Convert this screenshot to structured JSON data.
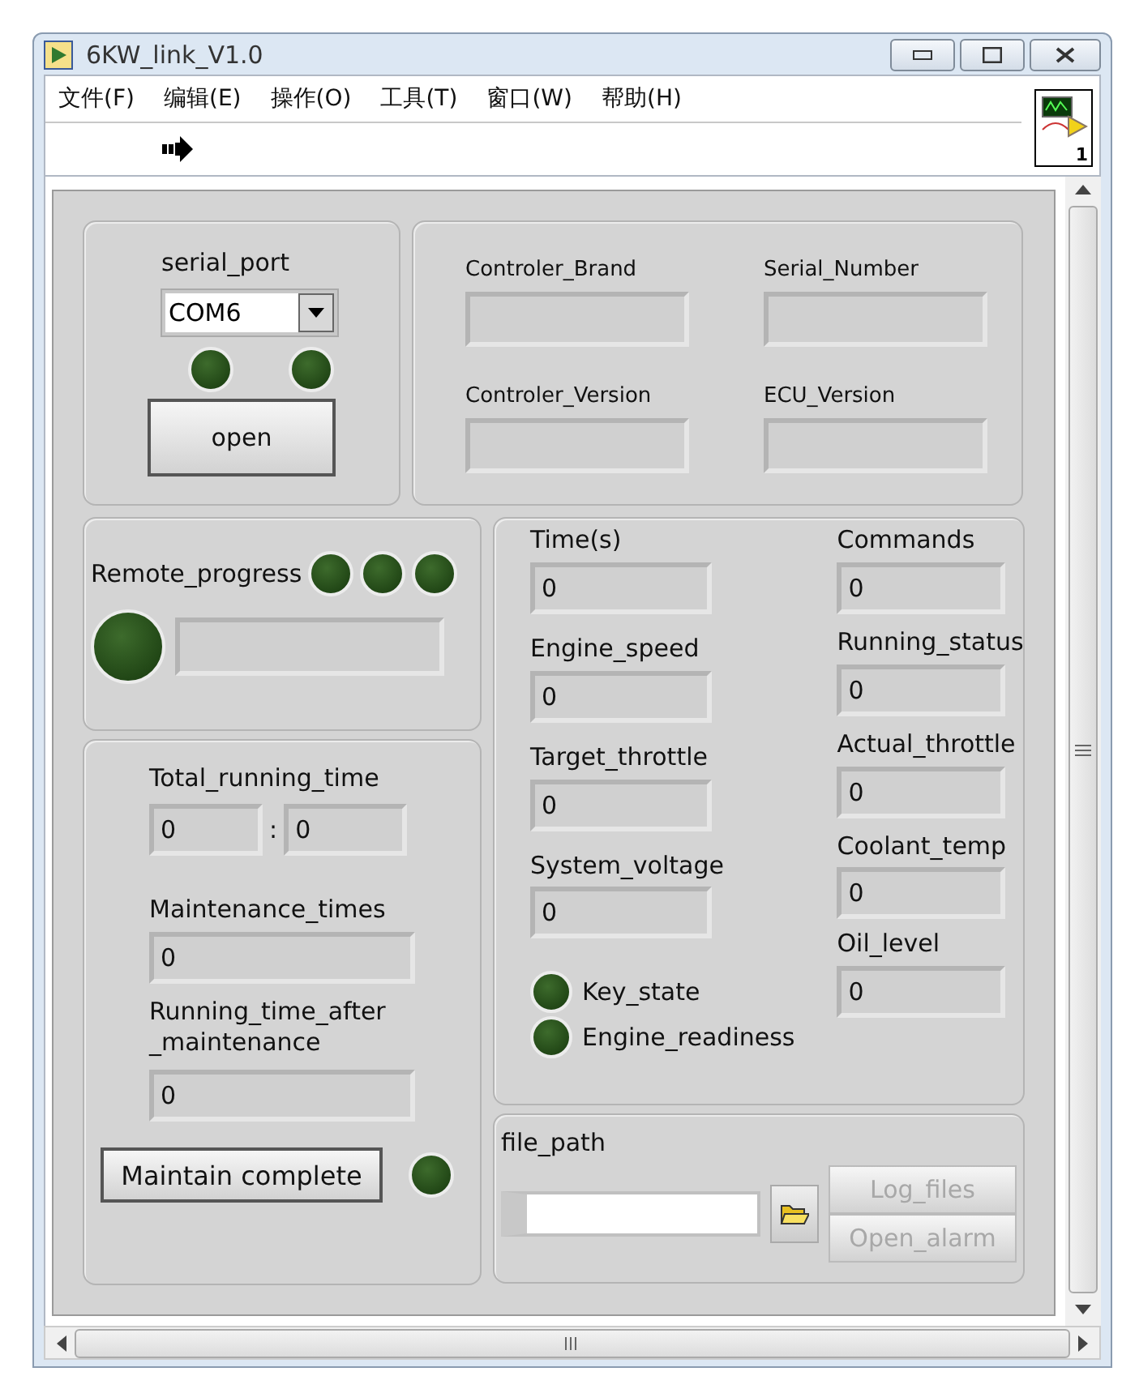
{
  "window": {
    "title": "6KW_link_V1.0"
  },
  "menu": [
    "文件(F)",
    "编辑(E)",
    "操作(O)",
    "工具(T)",
    "窗口(W)",
    "帮助(H)"
  ],
  "vi_icon": {
    "number": "1"
  },
  "serial": {
    "label": "serial_port",
    "value": "COM6",
    "leds": [
      {
        "on": false
      },
      {
        "on": false
      }
    ],
    "button": "open"
  },
  "info_fields": [
    {
      "label": "Controler_Brand"
    },
    {
      "label": "Serial_Number"
    },
    {
      "label": "Controler_Version"
    },
    {
      "label": "ECU_Version"
    }
  ],
  "remote": {
    "label": "Remote_progress",
    "leds": [
      {
        "on": false
      },
      {
        "on": false
      },
      {
        "on": false
      }
    ],
    "big_led": {
      "on": false
    }
  },
  "maintenance": {
    "total_label": "Total_running_time",
    "hours": "0",
    "separator": ":",
    "minutes": "0",
    "times_label": "Maintenance_times",
    "times": "0",
    "after_label": "Running_time_after\n_maintenance",
    "after": "0",
    "button": "Maintain complete",
    "led": {
      "on": false
    }
  },
  "values_left": [
    {
      "label": "Time(s)",
      "value": "0"
    },
    {
      "label": "Engine_speed",
      "value": "0"
    },
    {
      "label": "Target_throttle",
      "value": "0"
    },
    {
      "label": "System_voltage",
      "value": "0"
    }
  ],
  "values_right": [
    {
      "label": "Commands",
      "value": "0"
    },
    {
      "label": "Running_status",
      "value": "0"
    },
    {
      "label": "Actual_throttle",
      "value": "0"
    },
    {
      "label": "Coolant_temp",
      "value": "0"
    },
    {
      "label": "Oil_level",
      "value": "0"
    }
  ],
  "status_leds": [
    {
      "label": "Key_state",
      "on": false
    },
    {
      "label": "Engine_readiness",
      "on": false
    }
  ],
  "file": {
    "label": "file_path",
    "buttons": [
      {
        "label": "Log_files",
        "disabled": true
      },
      {
        "label": "Open_alarm",
        "disabled": true
      }
    ]
  }
}
